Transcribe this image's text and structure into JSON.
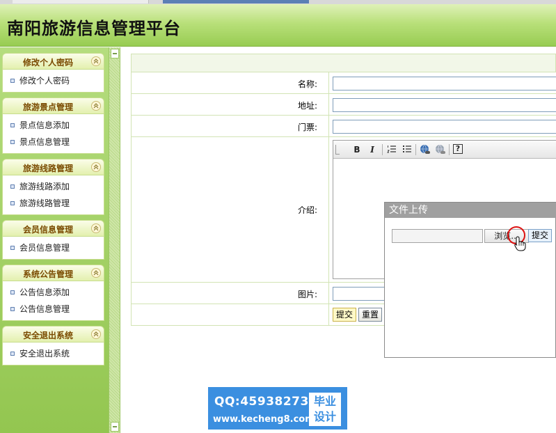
{
  "app": {
    "title": "南阳旅游信息管理平台"
  },
  "sidebar": {
    "groups": [
      {
        "title": "修改个人密码",
        "items": [
          "修改个人密码"
        ]
      },
      {
        "title": "旅游景点管理",
        "items": [
          "景点信息添加",
          "景点信息管理"
        ]
      },
      {
        "title": "旅游线路管理",
        "items": [
          "旅游线路添加",
          "旅游线路管理"
        ]
      },
      {
        "title": "会员信息管理",
        "items": [
          "会员信息管理"
        ]
      },
      {
        "title": "系统公告管理",
        "items": [
          "公告信息添加",
          "公告信息管理"
        ]
      },
      {
        "title": "安全退出系统",
        "items": [
          "安全退出系统"
        ]
      }
    ]
  },
  "form": {
    "fields": {
      "name_label": "名称:",
      "address_label": "地址:",
      "ticket_label": "门票:",
      "intro_label": "介绍:",
      "image_label": "图片:"
    },
    "submit_label": "提交",
    "reset_label": "重置"
  },
  "editor_toolbar": {
    "bold": "B",
    "italic": "I",
    "help": "?"
  },
  "upload_dialog": {
    "title": "文件上传",
    "browse_label": "浏览...",
    "submit_label": "提交"
  },
  "watermark": {
    "qq": "QQ:459382737",
    "url": "www.kecheng8.com",
    "badge_line1": "毕业",
    "badge_line2": "设计"
  },
  "colors": {
    "header_green": "#97cc52",
    "sidebar_green": "#93c650",
    "group_title": "#7a4a00",
    "watermark_blue": "#3b8fe0"
  }
}
